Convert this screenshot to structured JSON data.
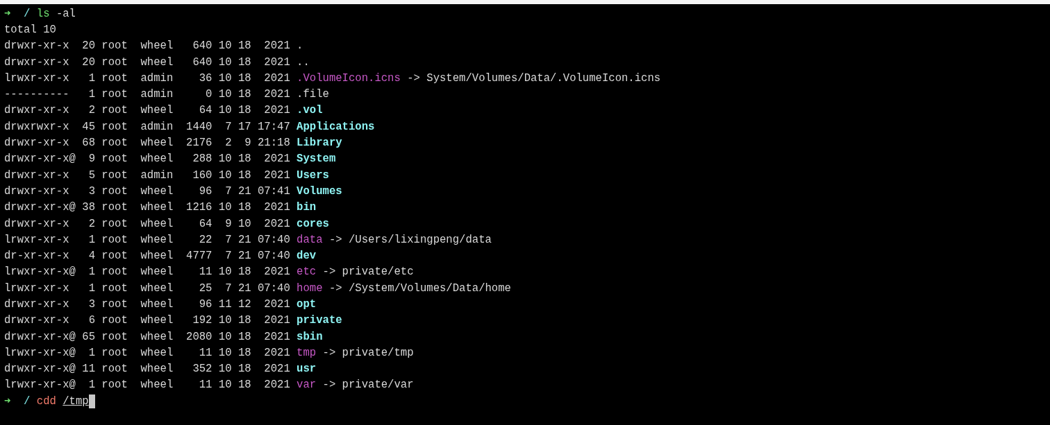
{
  "prompt": {
    "arrow": "➜",
    "cwd": "/",
    "command": "ls",
    "command_valid": true,
    "args": "-al"
  },
  "total": "total 10",
  "listing": [
    {
      "meta": "drwxr-xr-x  20 root  wheel   640 10 18  2021",
      "name": ".",
      "kind": "file"
    },
    {
      "meta": "drwxr-xr-x  20 root  wheel   640 10 18  2021",
      "name": "..",
      "kind": "file"
    },
    {
      "meta": "lrwxr-xr-x   1 root  admin    36 10 18  2021",
      "name": ".VolumeIcon.icns",
      "kind": "link",
      "target": "-> System/Volumes/Data/.VolumeIcon.icns"
    },
    {
      "meta": "----------   1 root  admin     0 10 18  2021",
      "name": ".file",
      "kind": "file"
    },
    {
      "meta": "drwxr-xr-x   2 root  wheel    64 10 18  2021",
      "name": ".vol",
      "kind": "dir"
    },
    {
      "meta": "drwxrwxr-x  45 root  admin  1440  7 17 17:47",
      "name": "Applications",
      "kind": "dir"
    },
    {
      "meta": "drwxr-xr-x  68 root  wheel  2176  2  9 21:18",
      "name": "Library",
      "kind": "dir"
    },
    {
      "meta": "drwxr-xr-x@  9 root  wheel   288 10 18  2021",
      "name": "System",
      "kind": "dir"
    },
    {
      "meta": "drwxr-xr-x   5 root  admin   160 10 18  2021",
      "name": "Users",
      "kind": "dir"
    },
    {
      "meta": "drwxr-xr-x   3 root  wheel    96  7 21 07:41",
      "name": "Volumes",
      "kind": "dir"
    },
    {
      "meta": "drwxr-xr-x@ 38 root  wheel  1216 10 18  2021",
      "name": "bin",
      "kind": "dir"
    },
    {
      "meta": "drwxr-xr-x   2 root  wheel    64  9 10  2021",
      "name": "cores",
      "kind": "dir"
    },
    {
      "meta": "lrwxr-xr-x   1 root  wheel    22  7 21 07:40",
      "name": "data",
      "kind": "link",
      "target": "-> /Users/lixingpeng/data"
    },
    {
      "meta": "dr-xr-xr-x   4 root  wheel  4777  7 21 07:40",
      "name": "dev",
      "kind": "dir"
    },
    {
      "meta": "lrwxr-xr-x@  1 root  wheel    11 10 18  2021",
      "name": "etc",
      "kind": "link",
      "target": "-> private/etc"
    },
    {
      "meta": "lrwxr-xr-x   1 root  wheel    25  7 21 07:40",
      "name": "home",
      "kind": "link",
      "target": "-> /System/Volumes/Data/home"
    },
    {
      "meta": "drwxr-xr-x   3 root  wheel    96 11 12  2021",
      "name": "opt",
      "kind": "dir"
    },
    {
      "meta": "drwxr-xr-x   6 root  wheel   192 10 18  2021",
      "name": "private",
      "kind": "dir"
    },
    {
      "meta": "drwxr-xr-x@ 65 root  wheel  2080 10 18  2021",
      "name": "sbin",
      "kind": "dir"
    },
    {
      "meta": "lrwxr-xr-x@  1 root  wheel    11 10 18  2021",
      "name": "tmp",
      "kind": "link",
      "target": "-> private/tmp"
    },
    {
      "meta": "drwxr-xr-x@ 11 root  wheel   352 10 18  2021",
      "name": "usr",
      "kind": "dir"
    },
    {
      "meta": "lrwxr-xr-x@  1 root  wheel    11 10 18  2021",
      "name": "var",
      "kind": "link",
      "target": "-> private/var"
    }
  ],
  "prompt2": {
    "arrow": "➜",
    "cwd": "/",
    "command": "cdd",
    "command_valid": false,
    "args": "/tmp"
  }
}
